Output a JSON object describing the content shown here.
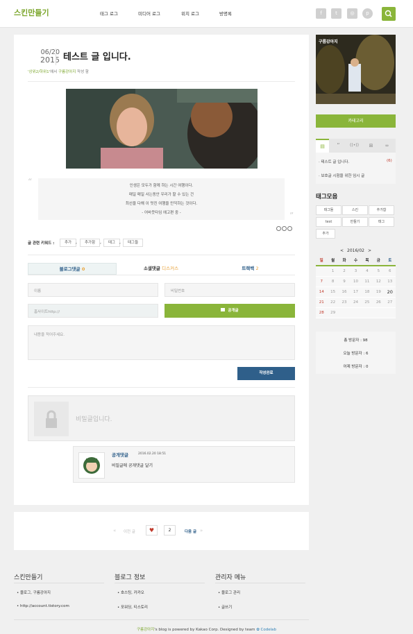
{
  "header": {
    "logo": "스킨만들기",
    "nav": [
      "태그 로그",
      "미디어 로그",
      "위치 로그",
      "방명록"
    ],
    "social_icons": [
      "facebook-icon",
      "twitter-icon",
      "instagram-icon",
      "pinterest-icon"
    ],
    "accent": "#8ab53a"
  },
  "post": {
    "date_md": "06/20",
    "date_year": "2015",
    "title": "테스트 글 입니다.",
    "meta_category": "'상위2/하위1'",
    "meta_mid": "에서 ",
    "meta_author": "구름강아지",
    "meta_end": " 작성 함",
    "quote_lines": [
      "인생은 모두가 함께 하는 시간 여행이다.",
      "매일 매일 사는동안 우리가 할 수 있는 건",
      "최선을 다해 이 멋진 여행을 만끽하는 것이다.",
      "- 어바웃타임 에고편 중 -"
    ],
    "keyword_label": "글 관련 키워드 :",
    "keywords": [
      "추가",
      "추가함",
      "태그",
      "태그들"
    ]
  },
  "comments": {
    "tabs": [
      {
        "label": "블로그댓글",
        "count": "0"
      },
      {
        "label": "소셜댓글",
        "count": "디스커스"
      },
      {
        "label": "트랙백",
        "count": "2"
      }
    ],
    "name_placeholder": "이름",
    "password_placeholder": "비밀번호",
    "homepage_placeholder": "홈사이트http://",
    "public_label": "공개글",
    "content_placeholder": "내용을 적어주세요.",
    "submit_label": "작성완료",
    "secret_text": "비밀글입니다.",
    "reply_author": "공개댓글",
    "reply_date": "2016.02.20 18:51",
    "reply_text": "비밀글에 공개댓글 달기"
  },
  "pager": {
    "prev": "이전 글",
    "likes": "2",
    "next": "다음 글"
  },
  "sidebar": {
    "profile_label": "구름강아지",
    "category_button": "카테고리",
    "recent_posts": [
      {
        "title": "테스트 글 입니다.",
        "count": "(6)"
      },
      {
        "title": "보호글 시험을 위한 임시 글",
        "count": ""
      }
    ],
    "tags_title": "태그모음",
    "tags": [
      "태그들",
      "스킨",
      "추가함",
      "test",
      "만들기",
      "태그",
      "추가"
    ],
    "calendar": {
      "month": "2016/02",
      "weekdays": [
        "일",
        "월",
        "화",
        "수",
        "목",
        "금",
        "토"
      ],
      "weeks": [
        [
          "",
          "1",
          "2",
          "3",
          "4",
          "5",
          "6"
        ],
        [
          "7",
          "8",
          "9",
          "10",
          "11",
          "12",
          "13"
        ],
        [
          "14",
          "15",
          "16",
          "17",
          "18",
          "19",
          "20"
        ],
        [
          "21",
          "22",
          "23",
          "24",
          "25",
          "26",
          "27"
        ],
        [
          "28",
          "29",
          "",
          "",
          "",
          "",
          ""
        ]
      ]
    },
    "visitors_total": "총 방문자 : 98",
    "visitors_today": "오늘 방문자 : 6",
    "visitors_yesterday": "어제 방문자 : 0"
  },
  "footer": {
    "col1_title": "스킨만들기",
    "col1_items": [
      "블로그, 구름강아지",
      "http://account.tistory.com"
    ],
    "col2_title": "블로그 정보",
    "col2_items": [
      "호스팅, 카카오",
      "포워딩, 티스토리"
    ],
    "col3_title": "관리자 메뉴",
    "col3_items": [
      "블로그 관리",
      "글쓰기"
    ],
    "copyright_name": "구름강아지",
    "copyright_mid": "'s blog is powered by Kakao Corp. Designed by team ",
    "copyright_team": "Codelab"
  }
}
